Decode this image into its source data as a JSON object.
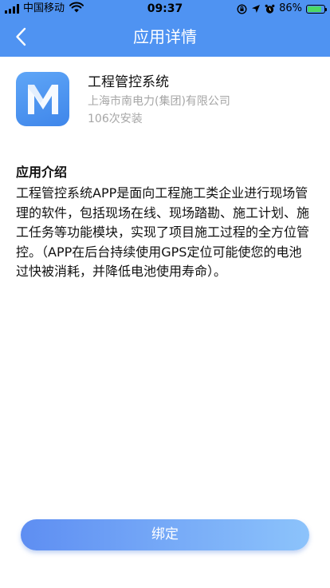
{
  "status_bar": {
    "carrier": "中国移动",
    "time": "09:37",
    "battery_percent": "86%",
    "battery_level": 0.86,
    "icons": [
      "signal-icon",
      "wifi-icon",
      "orientation-lock-icon",
      "location-icon",
      "alarm-icon",
      "battery-icon"
    ]
  },
  "nav": {
    "title": "应用详情",
    "back_icon": "chevron-left-icon"
  },
  "app": {
    "icon_letter": "M",
    "name": "工程管控系统",
    "company": "上海市南电力(集团)有限公司",
    "installs": "106次安装"
  },
  "intro": {
    "heading": "应用介绍",
    "body": "工程管控系统APP是面向工程施工类企业进行现场管理的软件，包括现场在线、现场踏勘、施工计划、施工任务等功能模块，实现了项目施工过程的全方位管控。（APP在后台持续使用GPS定位可能使您的电池过快被消耗，并降低电池使用寿命）。"
  },
  "actions": {
    "bind_label": "绑定"
  },
  "colors": {
    "primary": "#4f93f2",
    "button_start": "#5e8ef2",
    "button_end": "#8cc3fb",
    "secondary_text": "#a6a6a6"
  }
}
